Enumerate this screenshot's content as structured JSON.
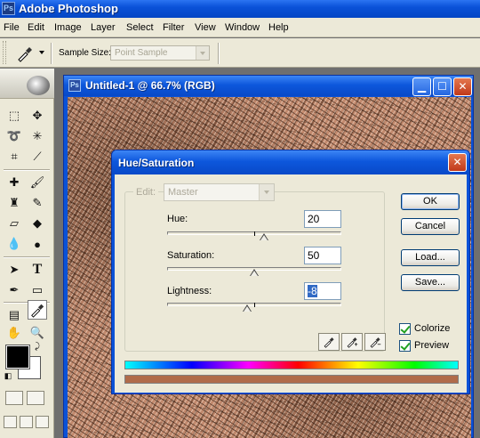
{
  "app": {
    "title": "Adobe Photoshop",
    "icon_text": "Ps"
  },
  "menu": [
    "File",
    "Edit",
    "Image",
    "Layer",
    "Select",
    "Filter",
    "View",
    "Window",
    "Help"
  ],
  "options": {
    "sample_size_label": "Sample Size:",
    "sample_size_value": "Point Sample"
  },
  "document": {
    "title": "Untitled-1 @ 66.7% (RGB)"
  },
  "dialog": {
    "title": "Hue/Saturation",
    "edit_label": "Edit:",
    "edit_value": "Master",
    "hue": {
      "label": "Hue:",
      "value": "20",
      "slider_fraction": 0.555
    },
    "saturation": {
      "label": "Saturation:",
      "value": "50",
      "slider_fraction": 0.5
    },
    "lightness": {
      "label": "Lightness:",
      "value": "-8",
      "slider_fraction": 0.46
    },
    "buttons": {
      "ok": "OK",
      "cancel": "Cancel",
      "load": "Load...",
      "save": "Save..."
    },
    "colorize": {
      "label": "Colorize",
      "checked": true
    },
    "preview": {
      "label": "Preview",
      "checked": true
    },
    "colorize_color": "#b06b4a"
  },
  "colors": {
    "foreground": "#000000",
    "background": "#ffffff",
    "xp_title": "#0a52d8"
  }
}
